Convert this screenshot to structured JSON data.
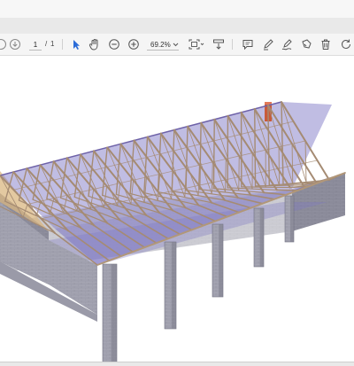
{
  "toolbar": {
    "page_current": "1",
    "page_separator": "/",
    "page_total": "1",
    "zoom_value": "69.2%",
    "icons": [
      "back-icon",
      "download-icon",
      "select-cursor-icon",
      "hand-icon",
      "zoom-out-icon",
      "zoom-in-icon",
      "fit-page-icon",
      "scroll-mode-icon",
      "comment-icon",
      "highlight-pen-icon",
      "sign-icon",
      "fill-sign-icon",
      "delete-icon",
      "rotate-icon"
    ]
  },
  "colors": {
    "toolbar_bg": "#f5f5f5",
    "select_accent": "#2b6cd8",
    "roof_glass": "#8c86cc",
    "timber": "#a58b73",
    "wall": "#a8a8b4",
    "chimney": "#c85a3a"
  }
}
